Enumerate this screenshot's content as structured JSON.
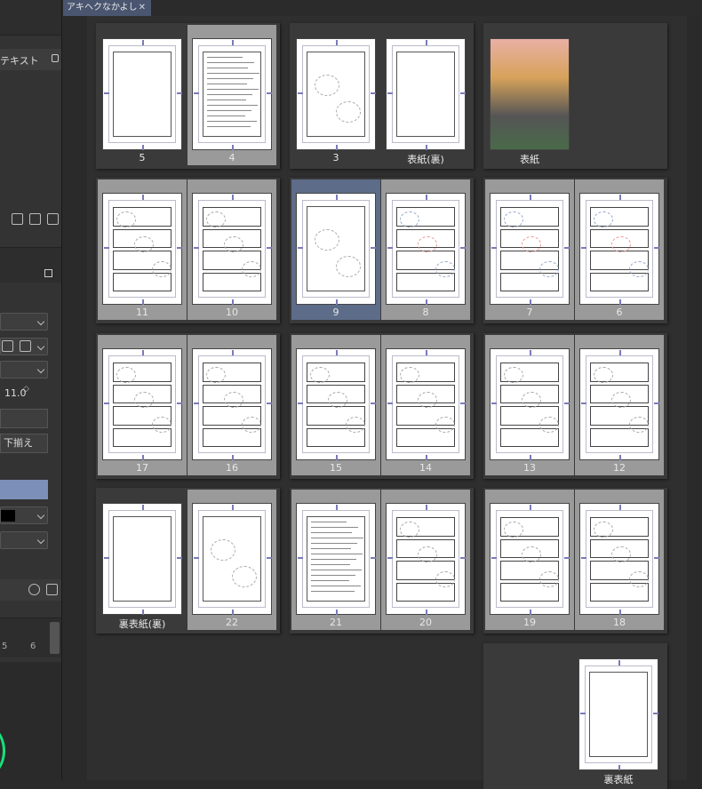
{
  "tab": {
    "title": "アキヘクなかよし",
    "close": "✕"
  },
  "left_panel": {
    "text_label": "テキスト",
    "font_size": "11.0",
    "align_button": "下揃え",
    "page_nums": [
      "5",
      "6"
    ]
  },
  "spreads": [
    {
      "pages": [
        {
          "label": "5",
          "type": "blank"
        },
        {
          "label": "4",
          "type": "text",
          "selected": true
        }
      ]
    },
    {
      "pages": [
        {
          "label": "3",
          "type": "sketch"
        },
        {
          "label": "表紙(裏)",
          "type": "blank"
        }
      ]
    },
    {
      "pages": [
        {
          "label": "表紙",
          "type": "cover"
        }
      ]
    },
    {
      "pages": [
        {
          "label": "11",
          "type": "panels",
          "selected": true
        },
        {
          "label": "10",
          "type": "panels",
          "selected": true
        }
      ]
    },
    {
      "pages": [
        {
          "label": "9",
          "type": "sketch",
          "active": true
        },
        {
          "label": "8",
          "type": "panels_red",
          "selected": true
        }
      ]
    },
    {
      "pages": [
        {
          "label": "7",
          "type": "panels_red",
          "selected": true
        },
        {
          "label": "6",
          "type": "panels_red",
          "selected": true
        }
      ]
    },
    {
      "pages": [
        {
          "label": "17",
          "type": "panels",
          "selected": true
        },
        {
          "label": "16",
          "type": "panels",
          "selected": true
        }
      ]
    },
    {
      "pages": [
        {
          "label": "15",
          "type": "panels",
          "selected": true
        },
        {
          "label": "14",
          "type": "panels",
          "selected": true
        }
      ]
    },
    {
      "pages": [
        {
          "label": "13",
          "type": "panels",
          "selected": true
        },
        {
          "label": "12",
          "type": "panels",
          "selected": true
        }
      ]
    },
    {
      "pages": [
        {
          "label": "裏表紙(裏)",
          "type": "blank"
        },
        {
          "label": "22",
          "type": "sketch",
          "selected": true
        }
      ]
    },
    {
      "pages": [
        {
          "label": "21",
          "type": "text",
          "selected": true
        },
        {
          "label": "20",
          "type": "panels",
          "selected": true
        }
      ]
    },
    {
      "pages": [
        {
          "label": "19",
          "type": "panels",
          "selected": true
        },
        {
          "label": "18",
          "type": "panels",
          "selected": true
        }
      ]
    },
    {
      "pages": [
        {
          "label": "裏表紙",
          "type": "blank"
        }
      ]
    }
  ],
  "colors": {
    "accent": "#5d6c88",
    "selected": "#9a9a9a",
    "panel_bg": "#3a3a3a",
    "canvas_bg": "#2f2f2f"
  }
}
